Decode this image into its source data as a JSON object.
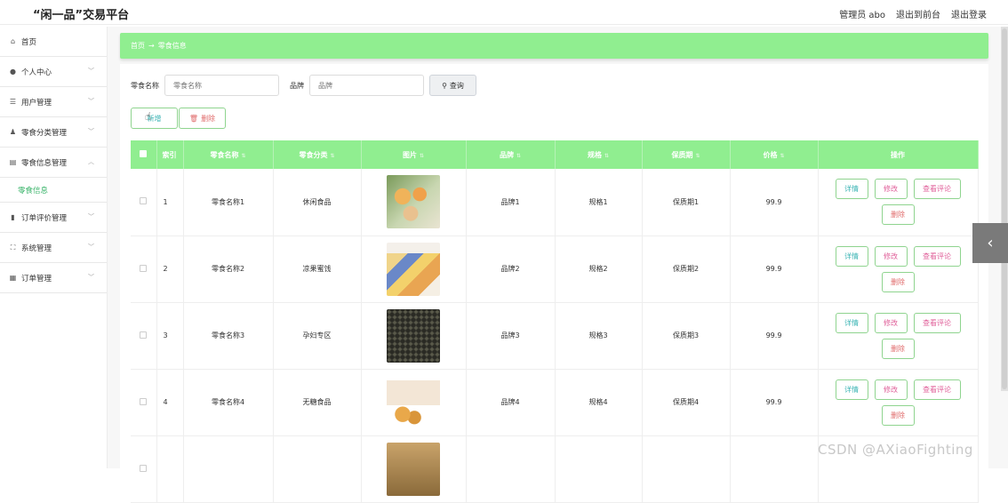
{
  "header": {
    "title": "“闲一品”交易平台",
    "admin": "管理员 abo",
    "back_to_front": "退出到前台",
    "logout": "退出登录"
  },
  "sidebar": {
    "items": [
      {
        "label": "首页",
        "icon": "home-icon"
      },
      {
        "label": "个人中心",
        "icon": "user-icon"
      },
      {
        "label": "用户管理",
        "icon": "list-icon"
      },
      {
        "label": "零食分类管理",
        "icon": "person-icon"
      },
      {
        "label": "零食信息管理",
        "icon": "store-icon"
      },
      {
        "label": "订单评价管理",
        "icon": "bar-chart-icon"
      },
      {
        "label": "系统管理",
        "icon": "expand-icon"
      },
      {
        "label": "订单管理",
        "icon": "clipboard-icon"
      }
    ],
    "sub_item": "零食信息"
  },
  "breadcrumb": {
    "home": "首页",
    "arrow": "→",
    "current": "零食信息"
  },
  "search": {
    "name_label": "零食名称",
    "name_placeholder": "零食名称",
    "brand_label": "品牌",
    "brand_placeholder": "品牌",
    "query_button": "查询"
  },
  "actions": {
    "add": "新增",
    "delete": "删除"
  },
  "table": {
    "columns": [
      "索引",
      "零食名称",
      "零食分类",
      "图片",
      "品牌",
      "规格",
      "保质期",
      "价格",
      "操作"
    ],
    "rows": [
      {
        "index": "1",
        "name": "零食名称1",
        "category": "休闲食品",
        "brand": "品牌1",
        "spec": "规格1",
        "shelf_life": "保质期1",
        "price": "99.9",
        "image": "food-photo"
      },
      {
        "index": "2",
        "name": "零食名称2",
        "category": "凉果蜜饯",
        "brand": "品牌2",
        "spec": "规格2",
        "shelf_life": "保质期2",
        "price": "99.9",
        "image": "food-photo"
      },
      {
        "index": "3",
        "name": "零食名称3",
        "category": "孕妇专区",
        "brand": "品牌3",
        "spec": "规格3",
        "shelf_life": "保质期3",
        "price": "99.9",
        "image": "food-photo"
      },
      {
        "index": "4",
        "name": "零食名称4",
        "category": "无糖食品",
        "brand": "品牌4",
        "spec": "规格4",
        "shelf_life": "保质期4",
        "price": "99.9",
        "image": "food-photo"
      }
    ],
    "ops": {
      "detail": "详情",
      "edit": "修改",
      "review": "查看评论",
      "delete": "删除"
    }
  },
  "watermark": "CSDN @AXiaoFighting",
  "colors": {
    "accent": "#90ee90",
    "active_menu": "#3bb46b"
  }
}
